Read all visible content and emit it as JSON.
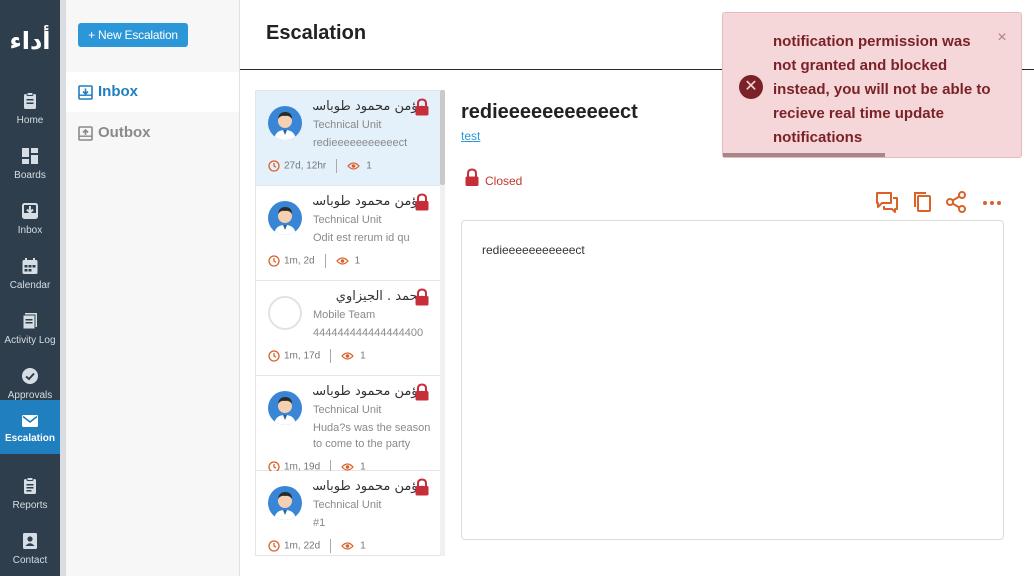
{
  "app": {
    "logo_text": "أداء"
  },
  "nav": {
    "items": [
      {
        "label": "Home",
        "icon": "clipboard-icon"
      },
      {
        "label": "Boards",
        "icon": "grid-icon"
      },
      {
        "label": "Inbox",
        "icon": "inbox-icon"
      },
      {
        "label": "Calendar",
        "icon": "calendar-icon"
      },
      {
        "label": "Activity Log",
        "icon": "activity-log-icon"
      },
      {
        "label": "Approvals",
        "icon": "check-circle-icon"
      },
      {
        "label": "Escalation",
        "icon": "envelope-icon",
        "active": true
      },
      {
        "label": "Reports",
        "icon": "report-icon"
      },
      {
        "label": "Contact",
        "icon": "contact-card-icon"
      }
    ]
  },
  "subnav": {
    "new_button": "+ New Escalation",
    "inbox": "Inbox",
    "outbox": "Outbox"
  },
  "header": {
    "title": "Escalation"
  },
  "list": {
    "items": [
      {
        "name": "مؤمن محمود طوباسي",
        "unit": "Technical Unit",
        "desc": "redieeeeeeeeeeect",
        "age": "27d, 12hr",
        "views": "1",
        "avatar": "person"
      },
      {
        "name": "مؤمن محمود طوباسي",
        "unit": "Technical Unit",
        "desc": "Odit est rerum id qu",
        "age": "1m, 2d",
        "views": "1",
        "avatar": "person"
      },
      {
        "name": "محمد . الجيزاوي",
        "unit": "Mobile Team",
        "desc": "444444444444444400",
        "age": "1m, 17d",
        "views": "1",
        "avatar": "blank"
      },
      {
        "name": "مؤمن محمود طوباسي",
        "unit": "Technical Unit",
        "desc": "Huda?s was the season to come to the party",
        "age": "1m, 19d",
        "views": "1",
        "avatar": "person"
      },
      {
        "name": "مؤمن محمود طوباسي",
        "unit": "Technical Unit",
        "desc": "#1",
        "age": "1m, 22d",
        "views": "1",
        "avatar": "person"
      }
    ]
  },
  "detail": {
    "title": "redieeeeeeeeeeect",
    "tag": "test",
    "status": "Closed",
    "body": "redieeeeeeeeeeect"
  },
  "toast": {
    "message": "notification permission was not granted and blocked instead, you will not be able to recieve real time update notifications",
    "close": "×",
    "progress": 0.54
  },
  "colors": {
    "rail": "#2e3e4c",
    "accent": "#2c97d8",
    "status_red": "#c0392b",
    "toolbar_orange": "#d9622b"
  }
}
